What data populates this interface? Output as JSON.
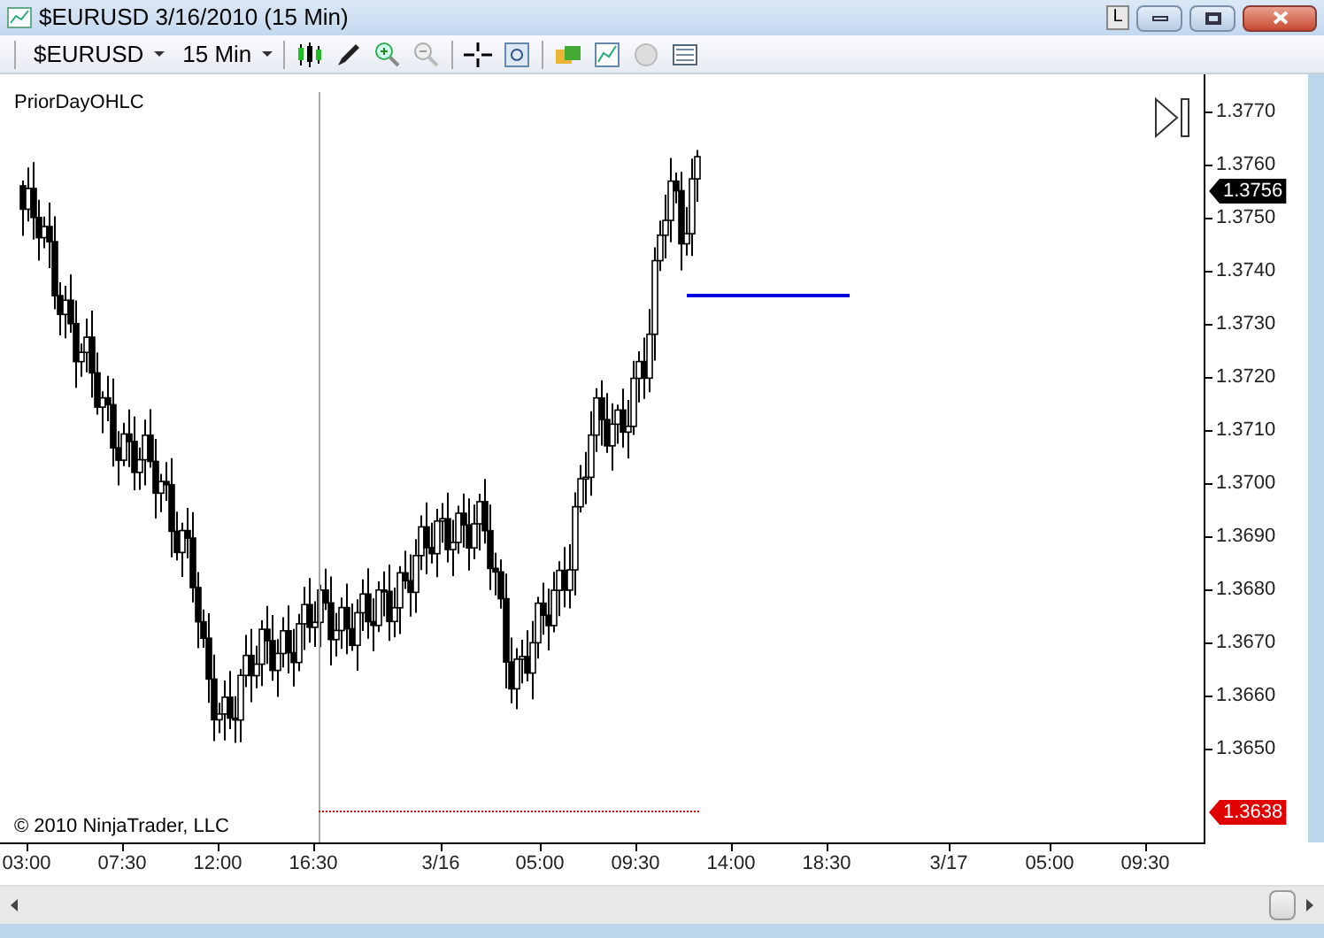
{
  "window": {
    "title": "$EURUSD  3/16/2010 (15 Min)",
    "layout_button": "L"
  },
  "toolbar": {
    "instrument": "$EURUSD",
    "interval": "15 Min"
  },
  "chart": {
    "indicator_label": "PriorDayOHLC",
    "copyright": "© 2010 NinjaTrader, LLC",
    "price_axis": [
      "1.3770",
      "1.3760",
      "1.3750",
      "1.3740",
      "1.3730",
      "1.3720",
      "1.3710",
      "1.3700",
      "1.3690",
      "1.3680",
      "1.3670",
      "1.3660",
      "1.3650"
    ],
    "last_price_marker": "1.3756",
    "low_marker": "1.3638",
    "time_axis": [
      "03:00",
      "07:30",
      "12:00",
      "16:30",
      "3/16",
      "05:00",
      "09:30",
      "14:00",
      "18:30",
      "3/17",
      "05:00",
      "09:30"
    ]
  }
}
